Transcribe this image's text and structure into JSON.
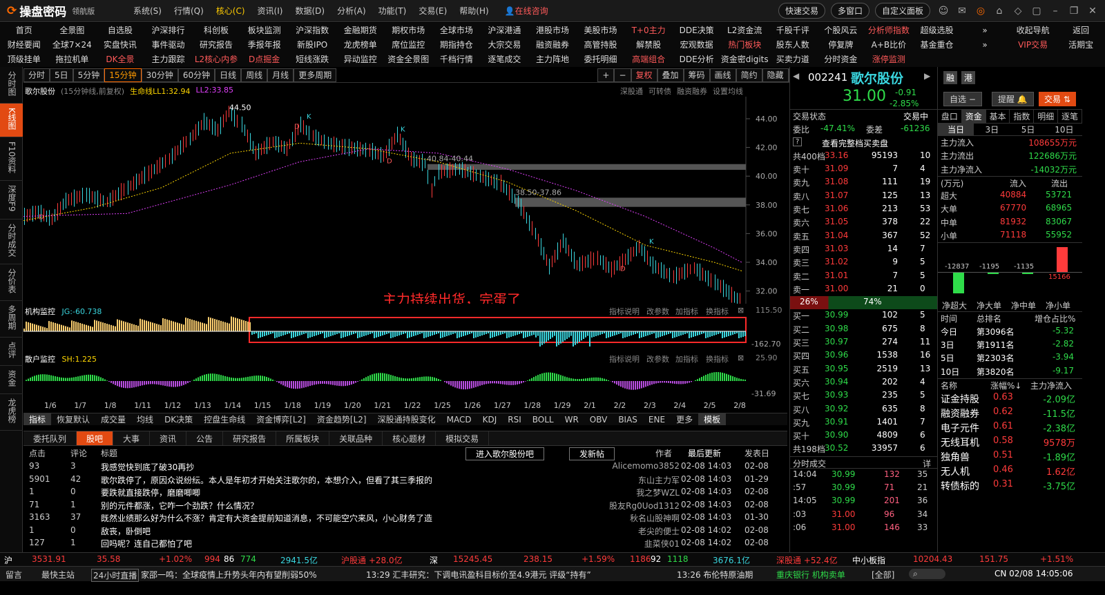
{
  "app": {
    "name": "操盘密码",
    "edition": "领航版",
    "consult": "在线咨询",
    "menus": [
      "系统(S)",
      "行情(Q)",
      "核心(C)",
      "资讯(I)",
      "数据(D)",
      "分析(A)",
      "功能(T)",
      "交易(E)",
      "帮助(H)"
    ],
    "quick_buttons": [
      "快速交易",
      "多窗口",
      "自定义面板"
    ]
  },
  "nav": {
    "rows": [
      [
        "首页",
        "全景图",
        "自选股",
        "沪深排行",
        "科创板",
        "板块监测",
        "沪深指数",
        "金融期货",
        "期权市场",
        "全球市场",
        "沪深港通",
        "港股市场",
        "美股市场",
        "T+0主力",
        "DDE决策",
        "L2资金流",
        "千股千评",
        "个股风云",
        "分析师指数",
        "超级选股",
        "»",
        "收起导航",
        "返回"
      ],
      [
        "财经要闻",
        "全球7×24",
        "实盘快讯",
        "事件驱动",
        "研究报告",
        "季报年报",
        "新股IPO",
        "龙虎榜单",
        "席位监控",
        "期指持仓",
        "大宗交易",
        "融资融券",
        "高管持股",
        "解禁股",
        "宏观数据",
        "热门板块",
        "股东人数",
        "停复牌",
        "A+B比价",
        "基金重仓",
        "»",
        "VIP交易",
        "活期宝"
      ],
      [
        "顶级挂单",
        "拖拉机单",
        "DK全景",
        "主力跟踪",
        "L2核心内参",
        "D点掘金",
        "短线涨跌",
        "异动监控",
        "资金全景图",
        "千档行情",
        "逐笔成交",
        "主力阵地",
        "委托明细",
        "高端组合",
        "DDE分析",
        "资金密digits",
        "买卖力道",
        "分时资金",
        "涨停监测",
        "",
        "",
        "",
        ""
      ]
    ]
  },
  "leftbar": [
    "分时图",
    "K线图",
    "F10资料",
    "深度F9",
    "分时成交",
    "分价表",
    "多周期",
    "点评",
    "资金",
    "龙虎榜"
  ],
  "periods": [
    "分时",
    "5日",
    "5分钟",
    "15分钟",
    "30分钟",
    "60分钟",
    "日线",
    "周线",
    "月线",
    "更多周期"
  ],
  "chart_tools": [
    "复权",
    "叠加",
    "筹码",
    "画线",
    "简约",
    "隐藏"
  ],
  "chart_info": {
    "stock": "歌尔股份",
    "desc": "(15分钟线,前复权)",
    "l1": "生命线LL1:32.94",
    "l2": "LL2:33.85",
    "links": [
      "深股通",
      "可转债",
      "融资融券",
      "设置均线"
    ]
  },
  "annotation": "主力持续出货，完蛋了",
  "price_labels": {
    "high": "44.50",
    "low": "30.90",
    "gap1": "40.84-40.44",
    "gap2": "38.50-37.86"
  },
  "yaxis": [
    "44.00",
    "42.00",
    "40.00",
    "38.00",
    "36.00",
    "34.00",
    "32.00"
  ],
  "indic1": {
    "name": "机构监控",
    "value": "JG:-60.738",
    "max": "115.50",
    "min": "-162.70",
    "tools": [
      "指标说明",
      "改参数",
      "加指标",
      "换指标"
    ]
  },
  "indic2": {
    "name": "散户监控",
    "value": "SH:1.225",
    "max": "25.90",
    "min": "-31.69",
    "tools": [
      "指标说明",
      "改参数",
      "加指标",
      "换指标"
    ]
  },
  "dates": [
    "1/6",
    "1/7",
    "1/8",
    "1/11",
    "1/12",
    "1/13",
    "1/14",
    "1/15",
    "1/18",
    "1/19",
    "1/20",
    "1/21",
    "1/22",
    "1/25",
    "1/26",
    "1/27",
    "1/28",
    "1/29",
    "2/1",
    "2/2",
    "2/3",
    "2/4",
    "2/5",
    "2/8"
  ],
  "indicator_tabs": [
    "指标",
    "恢复默认",
    "成交量",
    "均线",
    "DK决策",
    "控盘生命线",
    "资金博弈[L2]",
    "资金趋势[L2]",
    "深股通持股变化",
    "MACD",
    "KDJ",
    "RSI",
    "BOLL",
    "WR",
    "OBV",
    "BIAS",
    "ENE",
    "更多",
    "模板"
  ],
  "bottom_tabs": [
    "委托队列",
    "股吧",
    "大事",
    "资讯",
    "公告",
    "研究报告",
    "所属板块",
    "关联品种",
    "核心题材",
    "模拟交易"
  ],
  "forum": {
    "headers": [
      "点击",
      "评论",
      "标题",
      "作者",
      "最后更新",
      "发表日"
    ],
    "enter": "进入歌尔股份吧",
    "post": "发新帖",
    "rows": [
      [
        "93",
        "3",
        "我感觉快到底了破30再抄",
        "Alicemomo3852",
        "02-08 14:03",
        "02-08"
      ],
      [
        "5901",
        "42",
        "歌尔跌停了，原因众说纷纭。本人是年初才开始关注歌尔的，本想介入，但看了其三季报的",
        "东山主力军",
        "02-08 14:03",
        "01-29"
      ],
      [
        "1",
        "0",
        "要跌就直接跌停，磨磨唧唧",
        "我之梦WZL",
        "02-08 14:03",
        "02-08"
      ],
      [
        "71",
        "1",
        "别的元件都涨，它咋一个劲跌？什么情况？",
        "股友Rg0Uod1312",
        "02-08 14:03",
        "02-08"
      ],
      [
        "3163",
        "37",
        "既然业绩那么好为什么不涨？肯定有大资金提前知道消息，不可能空穴来风，小心财务了造",
        "秋名山股神啊",
        "02-08 14:03",
        "01-30"
      ],
      [
        "1",
        "0",
        "敌丧，卧倒吧",
        "老尖的便士",
        "02-08 14:02",
        "02-08"
      ],
      [
        "127",
        "1",
        "回吗呢？连自己都怕了吧",
        "韭菜侠01",
        "02-08 14:02",
        "02-08"
      ]
    ]
  },
  "quote": {
    "code": "002241",
    "name": "歌尔股份",
    "price": "31.00",
    "change": "-0.91",
    "pct": "-2.85%",
    "btns": [
      "自选",
      "提醒",
      "交易"
    ],
    "tags": [
      "融",
      "港"
    ]
  },
  "book": {
    "status_label": "交易状态",
    "status": "交易中",
    "wb_label": "委比",
    "wb": "-47.41%",
    "wc_label": "委差",
    "wc": "-61236",
    "full": "查看完整档买卖盘",
    "top": [
      "共400档",
      "33.16",
      "95193",
      "10"
    ],
    "sells": [
      [
        "卖十",
        "31.09",
        "7",
        "4"
      ],
      [
        "卖九",
        "31.08",
        "111",
        "19"
      ],
      [
        "卖八",
        "31.07",
        "125",
        "13"
      ],
      [
        "卖七",
        "31.06",
        "213",
        "53"
      ],
      [
        "卖六",
        "31.05",
        "378",
        "22"
      ],
      [
        "卖五",
        "31.04",
        "367",
        "52"
      ],
      [
        "卖四",
        "31.03",
        "14",
        "7"
      ],
      [
        "卖三",
        "31.02",
        "9",
        "5"
      ],
      [
        "卖二",
        "31.01",
        "7",
        "5"
      ],
      [
        "卖一",
        "31.00",
        "21",
        "0"
      ]
    ],
    "ratio": [
      "26%",
      "74%"
    ],
    "buys": [
      [
        "买一",
        "30.99",
        "102",
        "5"
      ],
      [
        "买二",
        "30.98",
        "675",
        "8"
      ],
      [
        "买三",
        "30.97",
        "274",
        "11"
      ],
      [
        "买四",
        "30.96",
        "1538",
        "16"
      ],
      [
        "买五",
        "30.95",
        "2519",
        "13"
      ],
      [
        "买六",
        "30.94",
        "202",
        "4"
      ],
      [
        "买七",
        "30.93",
        "235",
        "5"
      ],
      [
        "买八",
        "30.92",
        "635",
        "8"
      ],
      [
        "买九",
        "30.91",
        "1401",
        "7"
      ],
      [
        "买十",
        "30.90",
        "4809",
        "6"
      ]
    ],
    "bottom": [
      "共198档",
      "30.52",
      "33957",
      "6"
    ]
  },
  "ticks": {
    "label": "分时成交",
    "detail": "详",
    "rows": [
      [
        "14:04",
        "30.99",
        "132",
        "35"
      ],
      [
        ":57",
        "30.99",
        "71",
        "21"
      ],
      [
        "14:05",
        "30.99",
        "201",
        "36"
      ],
      [
        ":03",
        "31.00",
        "96",
        "34"
      ],
      [
        ":06",
        "31.00",
        "146",
        "33"
      ]
    ]
  },
  "fund": {
    "tabs": [
      "盘口",
      "资金",
      "基本",
      "指数",
      "明细",
      "逐笔"
    ],
    "subtabs": [
      "当日",
      "3日",
      "5日",
      "10日"
    ],
    "flows": [
      [
        "主力流入",
        "108655万元"
      ],
      [
        "主力流出",
        "122686万元"
      ],
      [
        "主力净流入",
        "-14032万元"
      ]
    ],
    "cols": [
      "(万元)",
      "流入",
      "流出"
    ],
    "sizes": [
      [
        "超大",
        "40884",
        "53721"
      ],
      [
        "大单",
        "67770",
        "68965"
      ],
      [
        "中单",
        "81932",
        "83067"
      ],
      [
        "小单",
        "71118",
        "55952"
      ]
    ],
    "net_bars": [
      "-12837",
      "-1195",
      "-1135",
      "15166"
    ],
    "net_labels": [
      "净超大",
      "净大单",
      "净中单",
      "净小单"
    ],
    "rank_hdr": [
      "时间",
      "总排名",
      "增仓占比%"
    ],
    "ranks": [
      [
        "今日",
        "第3096名",
        "-5.32"
      ],
      [
        "3日",
        "第1911名",
        "-2.82"
      ],
      [
        "5日",
        "第2303名",
        "-3.94"
      ],
      [
        "10日",
        "第3820名",
        "-9.17"
      ]
    ],
    "sect_hdr": [
      "名称",
      "涨幅%↓",
      "主力净流入"
    ],
    "sectors": [
      [
        "证金持股",
        "0.63",
        "-2.09亿"
      ],
      [
        "融资融券",
        "0.62",
        "-11.5亿"
      ],
      [
        "电子元件",
        "0.61",
        "-2.38亿"
      ],
      [
        "无线耳机",
        "0.58",
        "9578万"
      ],
      [
        "独角兽",
        "0.51",
        "-1.89亿"
      ],
      [
        "无人机",
        "0.46",
        "1.62亿"
      ],
      [
        "转债标的",
        "0.31",
        "-3.75亿"
      ]
    ]
  },
  "status": {
    "sh_label": "沪",
    "sh": "3531.91",
    "sh_chg": "35.58",
    "sh_pct": "+1.02%",
    "sh_up": "994",
    "sh_flat": "86",
    "sh_dn": "774",
    "sh_amt": "2941.5亿",
    "hgt": "沪股通 +28.0亿",
    "sz_label": "深",
    "sz": "15245.45",
    "sz_chg": "238.15",
    "sz_pct": "+1.59%",
    "sz_up": "1186",
    "sz_flat": "92",
    "sz_dn": "1118",
    "sz_amt": "3676.1亿",
    "sgt": "深股通 +52.4亿",
    "zxb": "中小板指",
    "zxb_v": "10204.43",
    "zxb_chg": "151.75",
    "zxb_pct": "+1.51%"
  },
  "news": {
    "left": [
      "留言",
      "最快主站",
      "24小时直播"
    ],
    "items": [
      "家邵一鸣：全球疫情上升势头年内有望削弱50%",
      "13:29 汇丰研究：下调电讯盈科目标价至4.9港元 评级“持有”",
      "13:26 布伦特原油期"
    ],
    "stock_news": "重庆银行 机构卖单",
    "all": "[全部]",
    "clock": "CN 02/08 14:05:06"
  }
}
